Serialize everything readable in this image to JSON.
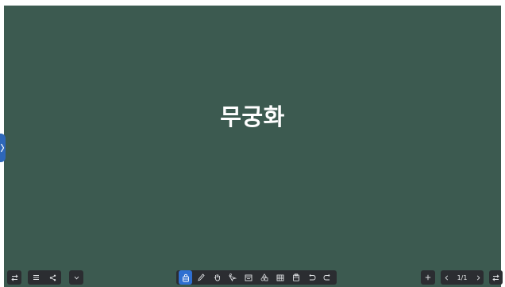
{
  "board": {
    "text": "무궁화",
    "background": "#3c5a50"
  },
  "toolbar_left": {
    "icons": [
      "swap-icon",
      "menu-icon",
      "share-icon",
      "chevron-down-icon"
    ]
  },
  "toolbar_center": {
    "tools": [
      {
        "icon": "select-tool-icon",
        "active": true
      },
      {
        "icon": "pen-icon",
        "active": false
      },
      {
        "icon": "hand-icon",
        "active": false
      },
      {
        "icon": "laser-pointer-icon",
        "active": false
      },
      {
        "icon": "text-box-icon",
        "active": false
      },
      {
        "icon": "shapes-icon",
        "active": false
      },
      {
        "icon": "table-icon",
        "active": false
      },
      {
        "icon": "clipboard-icon",
        "active": false
      },
      {
        "icon": "undo-icon",
        "active": false
      },
      {
        "icon": "redo-icon",
        "active": false
      }
    ],
    "accent": "#2f6fd1"
  },
  "toolbar_right": {
    "page_indicator": "1/1",
    "icons": [
      "plus-icon",
      "prev-page-icon",
      "next-page-icon",
      "swap-icon"
    ]
  }
}
